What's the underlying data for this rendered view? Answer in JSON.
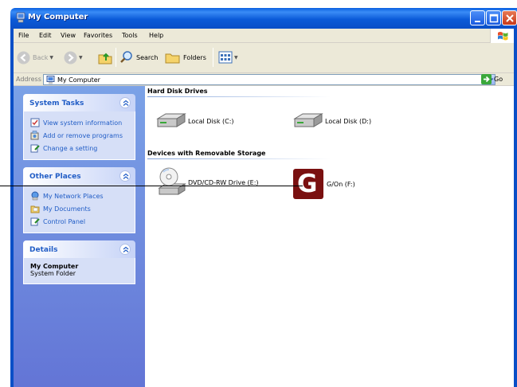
{
  "window": {
    "title": "My Computer"
  },
  "menu": [
    "File",
    "Edit",
    "View",
    "Favorites",
    "Tools",
    "Help"
  ],
  "toolbar": {
    "back_label": "Back",
    "search_label": "Search",
    "folders_label": "Folders"
  },
  "address": {
    "label": "Address",
    "value": "My Computer",
    "go_label": "Go"
  },
  "system_tasks": {
    "title": "System Tasks",
    "items": [
      "View system information",
      "Add or remove programs",
      "Change a setting"
    ]
  },
  "other_places": {
    "title": "Other Places",
    "items": [
      "My Network Places",
      "My Documents",
      "Control Panel"
    ]
  },
  "details": {
    "title": "Details",
    "name": "My Computer",
    "type": "System Folder"
  },
  "groups": {
    "hard_disks": {
      "title": "Hard Disk Drives",
      "drives": [
        "Local Disk (C:)",
        "Local Disk (D:)"
      ]
    },
    "removable": {
      "title": "Devices with Removable Storage",
      "drives": [
        "DVD/CD-RW Drive (E:)",
        "G/On (F:)"
      ],
      "gon_letter": "G"
    }
  },
  "colors": {
    "titlebar": "#0a5fe0",
    "task_link": "#215dc6",
    "gon_brand": "#7a1010"
  }
}
